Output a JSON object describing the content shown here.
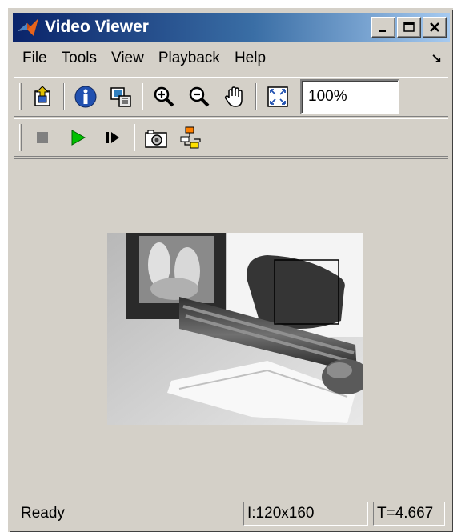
{
  "window": {
    "title": "Video Viewer",
    "minimize_label": "_",
    "close_label": "X"
  },
  "menu": {
    "items": [
      "File",
      "Tools",
      "View",
      "Playback",
      "Help"
    ],
    "dock_glyph": "↘"
  },
  "toolbar": {
    "zoom_value": "100%"
  },
  "status": {
    "text": "Ready",
    "size": "I:120x160",
    "time": "T=4.667"
  },
  "colors": {
    "titlebar_start": "#0a246a",
    "titlebar_end": "#a6caf0",
    "chrome": "#d4d0c8",
    "play_green": "#00c000",
    "stop_gray": "#808080"
  },
  "icons": {
    "app": "matlab-logo-icon",
    "parent": "parent-model-icon",
    "info": "info-icon",
    "export": "export-icon",
    "zoom_in": "zoom-in-icon",
    "zoom_out": "zoom-out-icon",
    "pan": "pan-hand-icon",
    "fit": "fit-to-window-icon",
    "stop": "stop-icon",
    "play": "play-icon",
    "step": "step-forward-icon",
    "snapshot": "snapshot-camera-icon",
    "highlight": "highlight-signal-icon"
  }
}
